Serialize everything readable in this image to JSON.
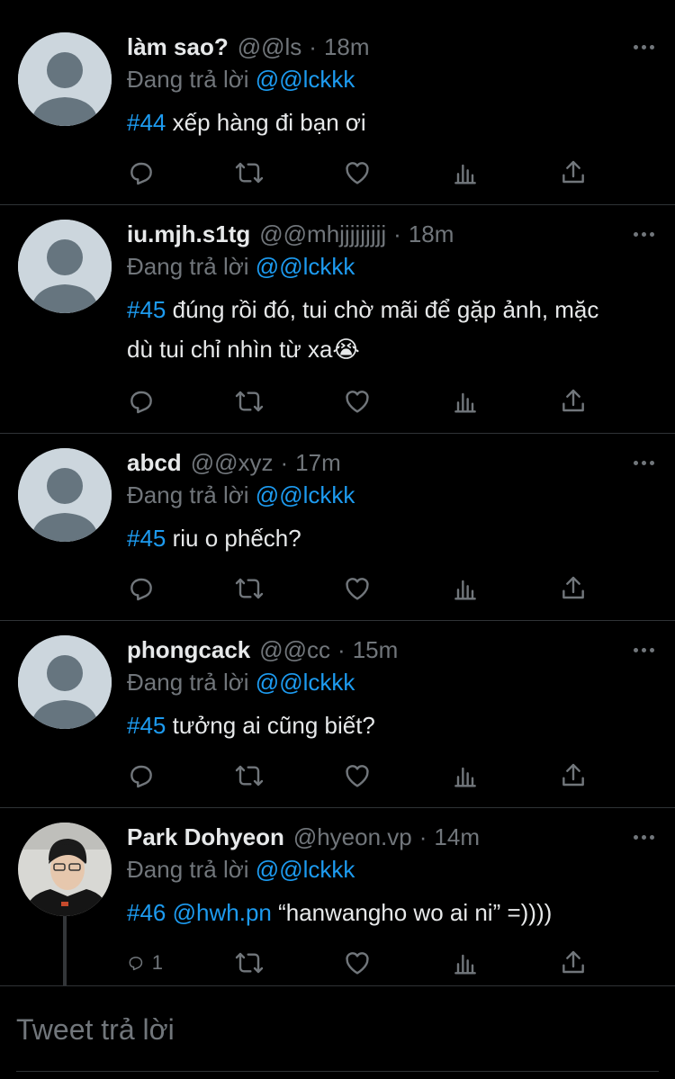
{
  "tweets": [
    {
      "name": "làm sao?",
      "handle": "@@ls",
      "time": "18m",
      "reply_prefix": "Đang trả lời",
      "reply_to": "@@lckkk",
      "tag": "#44",
      "text": " xếp hàng đi bạn ơi",
      "reply_count": "",
      "avatar": "default"
    },
    {
      "name": "iu.mjh.s1tg",
      "handle": "@@mhjjjjjjjjj",
      "time": "18m",
      "reply_prefix": "Đang trả lời",
      "reply_to": "@@lckkk",
      "tag": "#45",
      "text": " đúng rồi đó, tui chờ mãi để gặp ảnh, mặc dù tui chỉ nhìn từ xa😭",
      "reply_count": "",
      "avatar": "default"
    },
    {
      "name": "abcd",
      "handle": "@@xyz",
      "time": "17m",
      "reply_prefix": "Đang trả lời",
      "reply_to": "@@lckkk",
      "tag": "#45",
      "text": " riu o phếch?",
      "reply_count": "",
      "avatar": "default"
    },
    {
      "name": "phongcack",
      "handle": "@@cc",
      "time": "15m",
      "reply_prefix": "Đang trả lời",
      "reply_to": "@@lckkk",
      "tag": "#45",
      "text": " tưởng ai cũng biết?",
      "reply_count": "",
      "avatar": "default"
    },
    {
      "name": "Park Dohyeon",
      "handle": "@hyeon.vp",
      "time": "14m",
      "reply_prefix": "Đang trả lời",
      "reply_to": "@@lckkk",
      "tag": "#46",
      "mention": "@hwh.pn",
      "text": " “hanwangho wo ai ni” =))))",
      "reply_count": "1",
      "avatar": "photo"
    }
  ],
  "composer": {
    "placeholder": "Tweet trả lời"
  },
  "colors": {
    "background": "#000000",
    "text": "#e7e9ea",
    "secondary": "#71767b",
    "accent": "#1d9bf0",
    "divider": "#2f3336"
  },
  "icons": [
    "reply-icon",
    "retweet-icon",
    "like-icon",
    "views-icon",
    "share-icon",
    "more-icon"
  ]
}
